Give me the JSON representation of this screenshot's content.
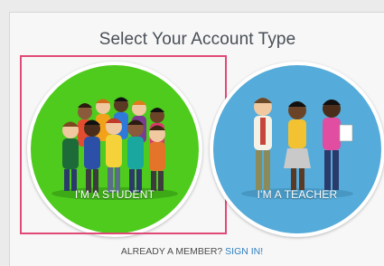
{
  "header": {
    "title": "Select Your Account Type"
  },
  "options": {
    "student": {
      "label": "I'M A STUDENT",
      "color": "#4ecb1d",
      "selected": true
    },
    "teacher": {
      "label": "I'M A TEACHER",
      "color": "#55abd9",
      "selected": false
    }
  },
  "footer": {
    "member_text": "ALREADY A MEMBER?",
    "sign_in_label": "SIGN IN!"
  },
  "colors": {
    "selection_border": "#e04a76",
    "link": "#2e7fbf"
  }
}
